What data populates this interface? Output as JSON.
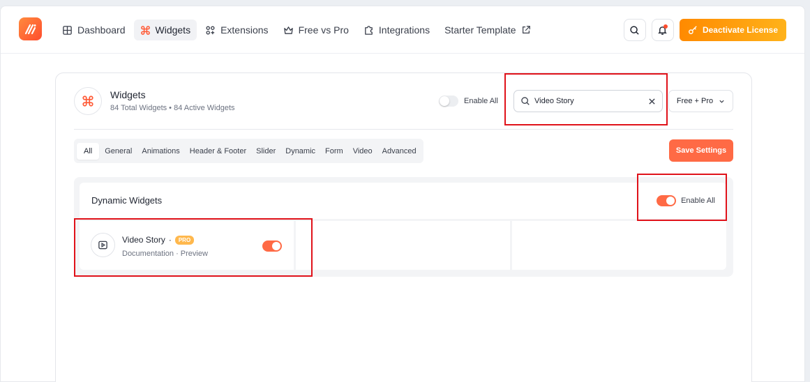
{
  "header": {
    "nav": [
      {
        "label": "Dashboard",
        "icon": "grid-icon"
      },
      {
        "label": "Widgets",
        "icon": "command-icon",
        "active": true
      },
      {
        "label": "Extensions",
        "icon": "extensions-icon"
      },
      {
        "label": "Free vs Pro",
        "icon": "crown-icon"
      },
      {
        "label": "Integrations",
        "icon": "puzzle-icon"
      },
      {
        "label": "Starter Template",
        "icon": "external-link-icon"
      }
    ],
    "license_label": "Deactivate License"
  },
  "widgets": {
    "title": "Widgets",
    "subtitle": "84 Total Widgets • 84 Active Widgets",
    "enable_all_label": "Enable All",
    "search_value": "Video Story",
    "filter_value": "Free + Pro"
  },
  "tabs": [
    "All",
    "General",
    "Animations",
    "Header & Footer",
    "Slider",
    "Dynamic",
    "Form",
    "Video",
    "Advanced"
  ],
  "save_label": "Save Settings",
  "group": {
    "title": "Dynamic Widgets",
    "enable_all_label": "Enable All",
    "items": [
      {
        "name": "Video Story",
        "separator": "·",
        "badge": "PRO",
        "doc_label": "Documentation",
        "link_separator": "·",
        "preview_label": "Preview",
        "enabled": true
      }
    ]
  },
  "colors": {
    "accent": "#ff6a45",
    "highlight": "#e0121a",
    "pro": "#ffb84d"
  }
}
